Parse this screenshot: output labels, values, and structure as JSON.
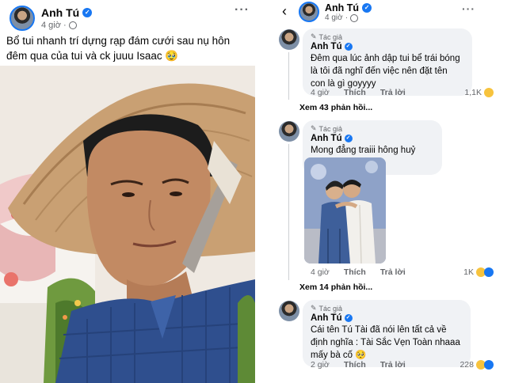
{
  "post": {
    "author": "Anh Tú",
    "time": "4 giờ",
    "caption": "Bổ tui nhanh trí dựng rạp đám cưới sau nụ hôn đêm qua của tui và ck juuu Isaac 🥹",
    "more_icon": "···"
  },
  "comments_header": {
    "author": "Anh Tú",
    "time": "4 giờ",
    "back_icon": "‹",
    "more_icon": "···"
  },
  "comments": [
    {
      "tag": "Tác giả",
      "author": "Anh Tú",
      "text": "Đêm qua lúc ảnh dập tui bể trái bóng là tôi đã nghĩ đến việc nên đặt tên con là gì goyyyy",
      "time": "4 giờ",
      "like": "Thích",
      "reply": "Trả lời",
      "reactions": "1,1K",
      "view_replies": "Xem 43 phản hồi..."
    },
    {
      "tag": "Tác giả",
      "author": "Anh Tú",
      "text": "Mong đẳng traiii hông huỷ hôn!!!!!",
      "time": "4 giờ",
      "like": "Thích",
      "reply": "Trả lời",
      "reactions": "1K",
      "view_replies": "Xem 14 phản hồi..."
    },
    {
      "tag": "Tác giả",
      "author": "Anh Tú",
      "text": "Cái tên Tú Tài đã nói lên tất cả về định nghĩa : Tài Sắc Vẹn Toàn nhaaa mấy bà cố 🥺",
      "time": "2 giờ",
      "like": "Thích",
      "reply": "Trả lời",
      "reactions": "228"
    }
  ],
  "colors": {
    "verified": "#1877f2",
    "bubble": "#f0f2f5",
    "secondary_text": "#65676b"
  }
}
